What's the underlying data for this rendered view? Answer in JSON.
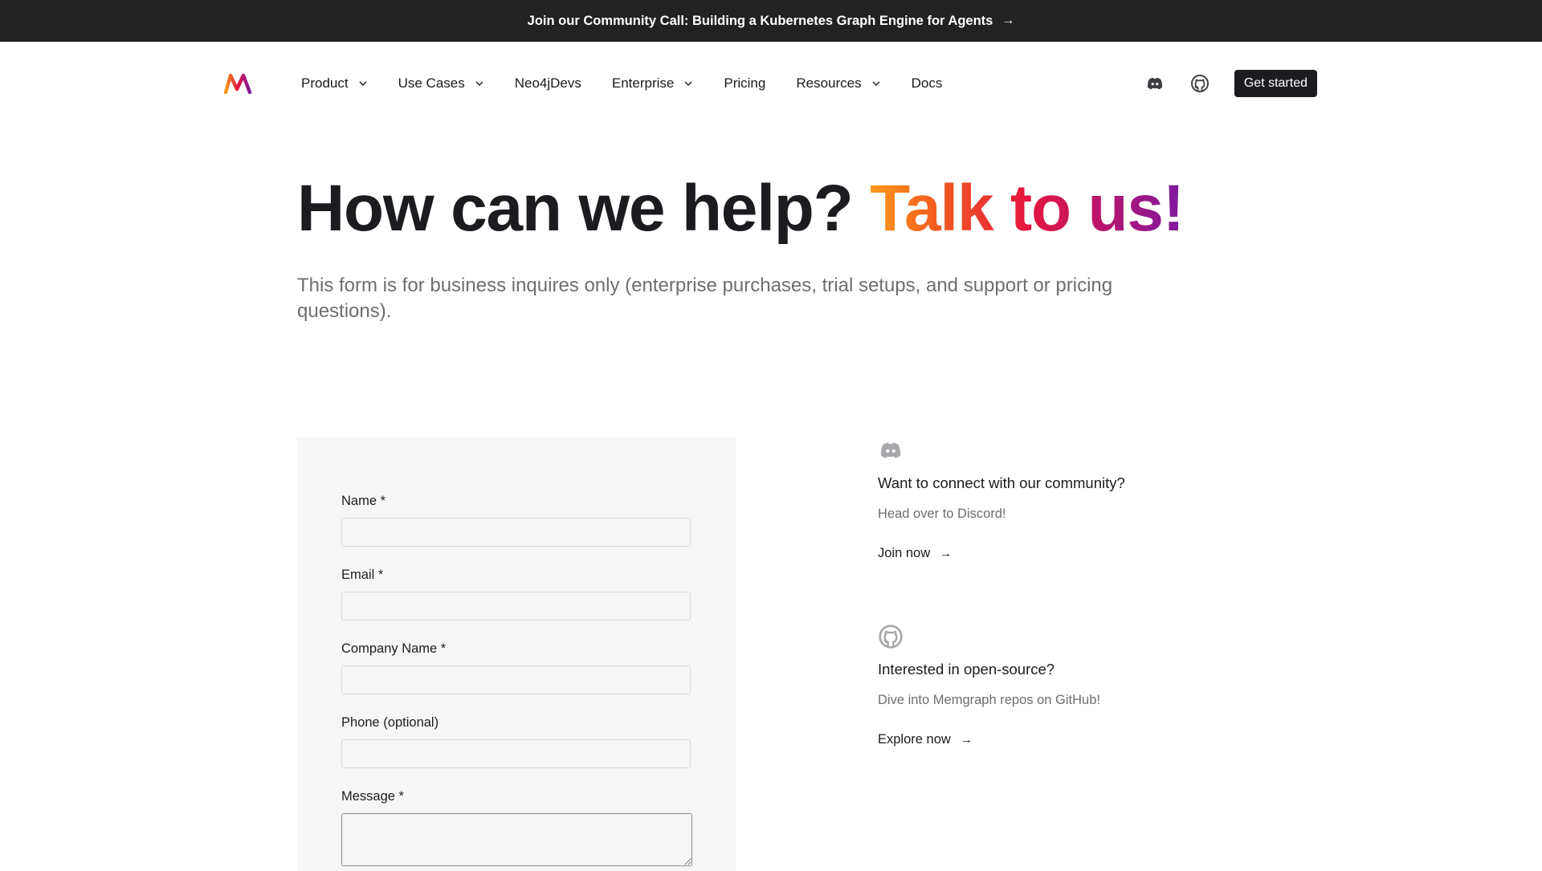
{
  "banner": {
    "text": "Join our Community Call: Building a Kubernetes Graph Engine for Agents",
    "arrow": "→"
  },
  "nav": {
    "logo": "memgraph-logo",
    "items": [
      {
        "label": "Product",
        "has_dropdown": true
      },
      {
        "label": "Use Cases",
        "has_dropdown": true
      },
      {
        "label": "Neo4jDevs",
        "has_dropdown": false
      },
      {
        "label": "Enterprise",
        "has_dropdown": true
      },
      {
        "label": "Pricing",
        "has_dropdown": false
      },
      {
        "label": "Resources",
        "has_dropdown": true
      },
      {
        "label": "Docs",
        "has_dropdown": false
      }
    ],
    "icons": [
      "discord-icon",
      "github-icon"
    ],
    "cta_label": "Get started"
  },
  "hero": {
    "title_plain": "How can we help? ",
    "title_highlight": "Talk to us!",
    "subtitle": "This form is for business inquires only (enterprise purchases, trial setups, and support or pricing questions)."
  },
  "form": {
    "fields": [
      {
        "label": "Name *",
        "value": "",
        "placeholder": ""
      },
      {
        "label": "Email *",
        "value": "",
        "placeholder": ""
      },
      {
        "label": "Company Name *",
        "value": "",
        "placeholder": ""
      },
      {
        "label": "Phone (optional)",
        "value": "",
        "placeholder": ""
      }
    ],
    "message": {
      "label": "Message *",
      "value": "",
      "placeholder": ""
    }
  },
  "community": {
    "icon": "discord-icon",
    "title": "Want to connect with our community?",
    "text": "Head over to Discord!",
    "link": "Join now",
    "arrow": "→"
  },
  "opensource": {
    "icon": "github-icon",
    "title": "Interested in open-source?",
    "text": "Dive into Memgraph repos on GitHub!",
    "link": "Explore now",
    "arrow": "→"
  },
  "colors": {
    "banner_bg": "#232223",
    "text_dark": "#1c1b1f",
    "text_muted": "#6f6d72",
    "form_bg": "#f7f6f7",
    "gradient": [
      "#fb9a1c",
      "#f25a1f",
      "#e5163f",
      "#b5156e",
      "#7d1aa0"
    ]
  }
}
